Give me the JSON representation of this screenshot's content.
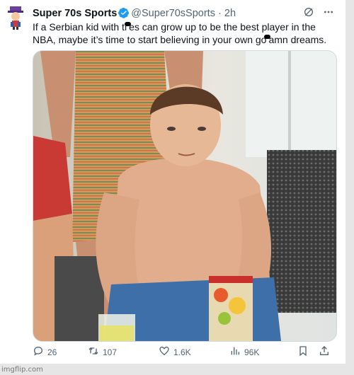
{
  "tweet": {
    "author_name": "Super 70s Sports",
    "handle": "@Super70sSports",
    "separator": "·",
    "time": "2h",
    "text_part1": "If a Serbian kid with ti",
    "text_part2": "es can grow up to be the best player in the NBA, maybe it’s time to start believing in your own go",
    "text_part3": "amn dreams.",
    "image_alt": "Photo"
  },
  "actions": {
    "replies": "26",
    "retweets": "107",
    "likes": "1.6K",
    "views": "96K"
  },
  "watermark": "imgflip.com",
  "colors": {
    "verified": "#1d9bf0",
    "muted": "#536471",
    "text": "#0f1419"
  },
  "icons": [
    "avatar",
    "verified-badge-icon",
    "grok-icon",
    "more-icon",
    "reply-icon",
    "retweet-icon",
    "like-icon",
    "views-icon",
    "bookmark-icon",
    "share-icon"
  ]
}
